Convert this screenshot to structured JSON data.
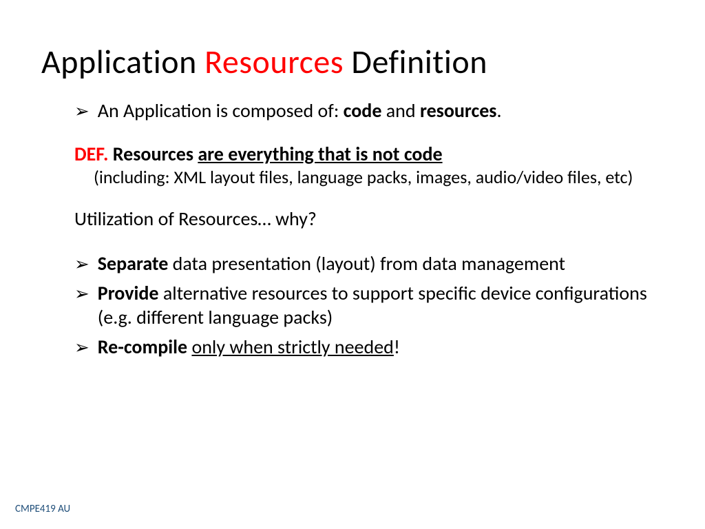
{
  "title": {
    "part1": "Application ",
    "part2": "Resources",
    "part3": " Definition"
  },
  "bullet1": {
    "pre": "An Application is composed of: ",
    "b1": "code",
    "mid": " and ",
    "b2": "resources",
    "post": "."
  },
  "def": {
    "label": "DEF.",
    "strong": " Resources ",
    "underline": "are everything that is not code",
    "sub": "(including: XML layout files, language packs, images, audio/video files, etc)"
  },
  "util": "Utilization of Resources… why?",
  "b2": {
    "strong": "Separate",
    "rest": " data presentation (layout) from data management"
  },
  "b3": {
    "strong": "Provide",
    "rest": " alternative resources to support specific device configurations (e.g. different language packs)"
  },
  "b4": {
    "strong": "Re-compile",
    "sp": " ",
    "underline": "only when strictly needed",
    "excl": "!"
  },
  "footer": "CMPE419 AU"
}
